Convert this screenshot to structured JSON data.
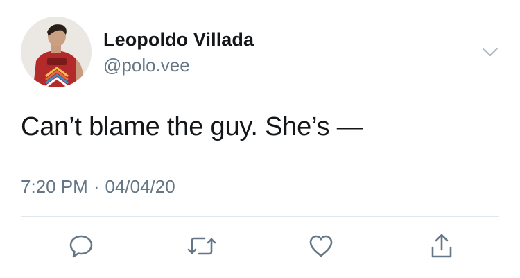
{
  "tweet": {
    "author": {
      "display_name": "Leopoldo Villada",
      "handle": "@polo.vee"
    },
    "text": "Can’t blame the guy. She’s —",
    "time": "7:20 PM",
    "separator": "·",
    "date": "04/04/20"
  },
  "actions": [
    {
      "name": "reply",
      "icon": "speech-bubble-icon"
    },
    {
      "name": "retweet",
      "icon": "retweet-arrows-icon"
    },
    {
      "name": "like",
      "icon": "heart-icon"
    },
    {
      "name": "share",
      "icon": "share-upload-icon"
    }
  ],
  "colors": {
    "text": "#14171a",
    "secondary": "#657786",
    "divider": "#e1e8ed",
    "icon": "#657786"
  }
}
